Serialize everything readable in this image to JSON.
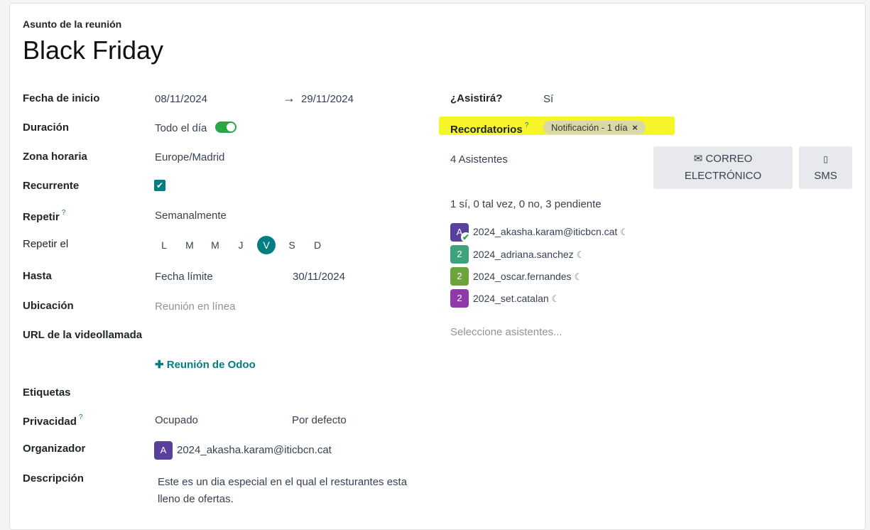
{
  "form": {
    "subject_label": "Asunto de la reunión",
    "title": "Black Friday"
  },
  "left": {
    "start_label": "Fecha de inicio",
    "start_value": "08/11/2024",
    "arrow": "→",
    "end_value": "29/11/2024",
    "duration_label": "Duración",
    "allday_label": "Todo el día",
    "timezone_label": "Zona horaria",
    "timezone_value": "Europe/Madrid",
    "recurrent_label": "Recurrente",
    "recurrent_checked": true,
    "repeat_label": "Repetir",
    "repeat_help": "?",
    "repeat_value": "Semanalmente",
    "repeat_on_label": "Repetir el",
    "days": [
      "L",
      "M",
      "M",
      "J",
      "V",
      "S",
      "D"
    ],
    "days_active": [
      false,
      false,
      false,
      false,
      true,
      false,
      false
    ],
    "until_label": "Hasta",
    "until_type": "Fecha límite",
    "until_value": "30/11/2024",
    "location_label": "Ubicación",
    "location_placeholder": "Reunión en línea",
    "video_label": "URL de la videollamada",
    "odoo_meeting": "Reunión de Odoo",
    "tags_label": "Etiquetas",
    "privacy_label": "Privacidad",
    "privacy_help": "?",
    "privacy_show_as": "Ocupado",
    "privacy_value": "Por defecto",
    "organizer_label": "Organizador",
    "organizer_initial": "A",
    "organizer_name": "2024_akasha.karam@iticbcn.cat",
    "description_label": "Descripción",
    "description_line1": "Este es un dia especial en el qual el resturantes esta",
    "description_line2": "lleno de ofertas."
  },
  "right": {
    "attend_label": "¿Asistirá?",
    "attend_value": "Sí",
    "reminders_label": "Recordatorios",
    "reminders_help": "?",
    "reminder_tag": "Notificación - 1 día",
    "remove_glyph": "×",
    "attendees_count": "4 Asistentes",
    "email_button_line1": "CORREO",
    "email_button_line2": "ELECTRÓNICO",
    "sms_button": "SMS",
    "summary": "1 sí, 0 tal vez, 0 no, 3 pendiente",
    "attendees": [
      {
        "initial": "A",
        "name": "2024_akasha.karam@iticbcn.cat",
        "color": "#5b3f9c",
        "accepted": true
      },
      {
        "initial": "2",
        "name": "2024_adriana.sanchez",
        "color": "#3ea27a",
        "accepted": false
      },
      {
        "initial": "2",
        "name": "2024_oscar.fernandes",
        "color": "#6aa43a",
        "accepted": false
      },
      {
        "initial": "2",
        "name": "2024_set.catalan",
        "color": "#8f3aa8",
        "accepted": false
      }
    ],
    "select_placeholder": "Seleccione asistentes..."
  },
  "colors": {
    "accent": "#017e84",
    "toggle_on": "#28a745",
    "highlight": "#f5f52a"
  }
}
